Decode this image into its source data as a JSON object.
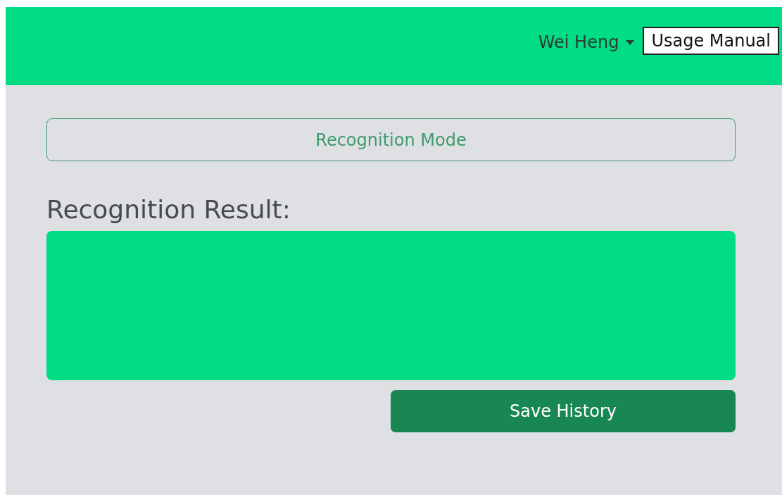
{
  "header": {
    "user_menu": {
      "label": "Wei Heng",
      "expanded": false
    },
    "manual_button": "Usage Manual"
  },
  "mode_button": "Recognition Mode",
  "result": {
    "heading": "Recognition Result:"
  },
  "save_button": "Save History"
}
